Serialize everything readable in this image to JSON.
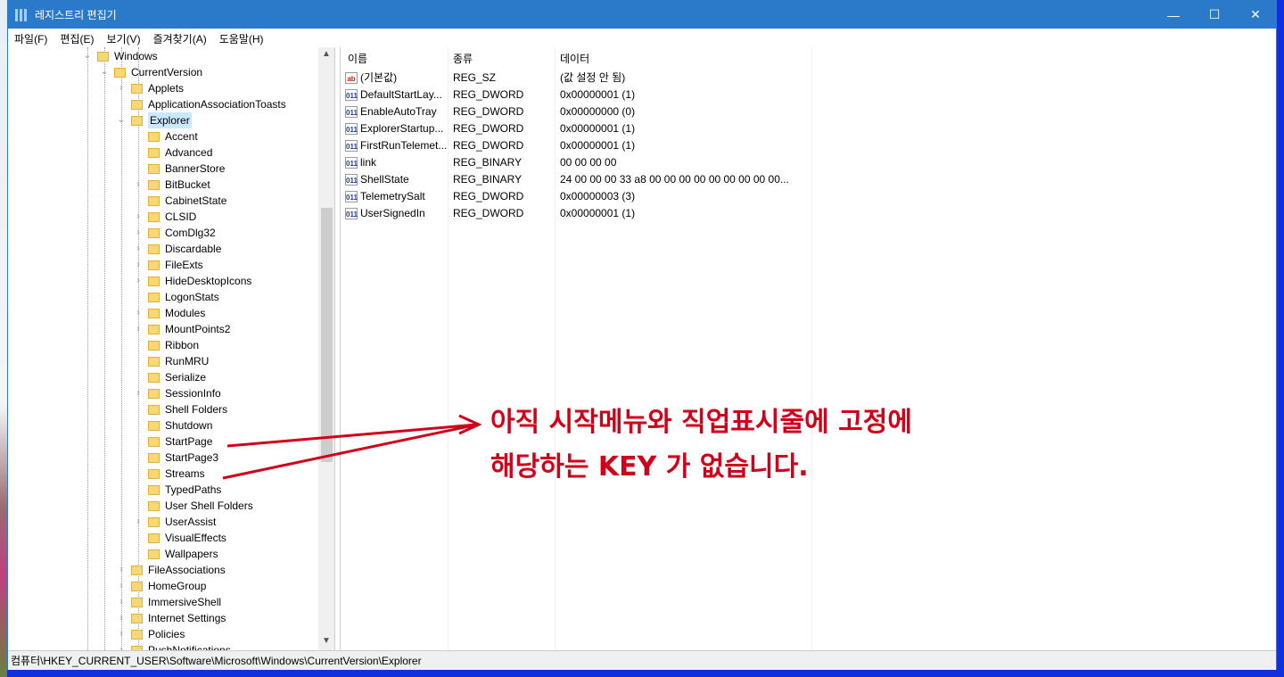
{
  "window": {
    "title": "레지스트리 편집기",
    "minimize": "—",
    "maximize": "☐",
    "close": "✕"
  },
  "menu": [
    "파일(F)",
    "편집(E)",
    "보기(V)",
    "즐겨찾기(A)",
    "도움말(H)"
  ],
  "tree": [
    {
      "label": "Windows",
      "level": 0,
      "exp": "open"
    },
    {
      "label": "CurrentVersion",
      "level": 1,
      "exp": "open"
    },
    {
      "label": "Applets",
      "level": 2,
      "exp": "closed"
    },
    {
      "label": "ApplicationAssociationToasts",
      "level": 2,
      "exp": "none"
    },
    {
      "label": "Explorer",
      "level": 2,
      "exp": "open",
      "selected": true
    },
    {
      "label": "Accent",
      "level": 3,
      "exp": "none"
    },
    {
      "label": "Advanced",
      "level": 3,
      "exp": "none"
    },
    {
      "label": "BannerStore",
      "level": 3,
      "exp": "none"
    },
    {
      "label": "BitBucket",
      "level": 3,
      "exp": "closed"
    },
    {
      "label": "CabinetState",
      "level": 3,
      "exp": "none"
    },
    {
      "label": "CLSID",
      "level": 3,
      "exp": "closed"
    },
    {
      "label": "ComDlg32",
      "level": 3,
      "exp": "closed"
    },
    {
      "label": "Discardable",
      "level": 3,
      "exp": "closed"
    },
    {
      "label": "FileExts",
      "level": 3,
      "exp": "closed"
    },
    {
      "label": "HideDesktopIcons",
      "level": 3,
      "exp": "closed"
    },
    {
      "label": "LogonStats",
      "level": 3,
      "exp": "none"
    },
    {
      "label": "Modules",
      "level": 3,
      "exp": "closed"
    },
    {
      "label": "MountPoints2",
      "level": 3,
      "exp": "closed"
    },
    {
      "label": "Ribbon",
      "level": 3,
      "exp": "none"
    },
    {
      "label": "RunMRU",
      "level": 3,
      "exp": "none"
    },
    {
      "label": "Serialize",
      "level": 3,
      "exp": "none"
    },
    {
      "label": "SessionInfo",
      "level": 3,
      "exp": "closed"
    },
    {
      "label": "Shell Folders",
      "level": 3,
      "exp": "none"
    },
    {
      "label": "Shutdown",
      "level": 3,
      "exp": "none"
    },
    {
      "label": "StartPage",
      "level": 3,
      "exp": "none"
    },
    {
      "label": "StartPage3",
      "level": 3,
      "exp": "none"
    },
    {
      "label": "Streams",
      "level": 3,
      "exp": "none"
    },
    {
      "label": "TypedPaths",
      "level": 3,
      "exp": "none"
    },
    {
      "label": "User Shell Folders",
      "level": 3,
      "exp": "none"
    },
    {
      "label": "UserAssist",
      "level": 3,
      "exp": "closed"
    },
    {
      "label": "VisualEffects",
      "level": 3,
      "exp": "none"
    },
    {
      "label": "Wallpapers",
      "level": 3,
      "exp": "none"
    },
    {
      "label": "FileAssociations",
      "level": 2,
      "exp": "closed"
    },
    {
      "label": "HomeGroup",
      "level": 2,
      "exp": "closed"
    },
    {
      "label": "ImmersiveShell",
      "level": 2,
      "exp": "closed"
    },
    {
      "label": "Internet Settings",
      "level": 2,
      "exp": "closed"
    },
    {
      "label": "Policies",
      "level": 2,
      "exp": "closed"
    },
    {
      "label": "PushNotifications",
      "level": 2,
      "exp": "closed"
    }
  ],
  "list": {
    "headers": [
      "이름",
      "종류",
      "데이터"
    ],
    "rows": [
      {
        "icon": "ab",
        "name": "(기본값)",
        "type": "REG_SZ",
        "data": "(값 설정 안 됨)"
      },
      {
        "icon": "bin",
        "name": "DefaultStartLay...",
        "type": "REG_DWORD",
        "data": "0x00000001 (1)"
      },
      {
        "icon": "bin",
        "name": "EnableAutoTray",
        "type": "REG_DWORD",
        "data": "0x00000000 (0)"
      },
      {
        "icon": "bin",
        "name": "ExplorerStartup...",
        "type": "REG_DWORD",
        "data": "0x00000001 (1)"
      },
      {
        "icon": "bin",
        "name": "FirstRunTelemet...",
        "type": "REG_DWORD",
        "data": "0x00000001 (1)"
      },
      {
        "icon": "bin",
        "name": "link",
        "type": "REG_BINARY",
        "data": "00 00 00 00"
      },
      {
        "icon": "bin",
        "name": "ShellState",
        "type": "REG_BINARY",
        "data": "24 00 00 00 33 a8 00 00 00 00 00 00 00 00 00..."
      },
      {
        "icon": "bin",
        "name": "TelemetrySalt",
        "type": "REG_DWORD",
        "data": "0x00000003 (3)"
      },
      {
        "icon": "bin",
        "name": "UserSignedIn",
        "type": "REG_DWORD",
        "data": "0x00000001 (1)"
      }
    ]
  },
  "status": "컴퓨터\\HKEY_CURRENT_USER\\Software\\Microsoft\\Windows\\CurrentVersion\\Explorer",
  "annotation": {
    "line1": "아직 시작메뉴와 직업표시줄에 고정에",
    "line2": "해당하는 KEY 가 없습니다.",
    "color": "#d0001a"
  }
}
